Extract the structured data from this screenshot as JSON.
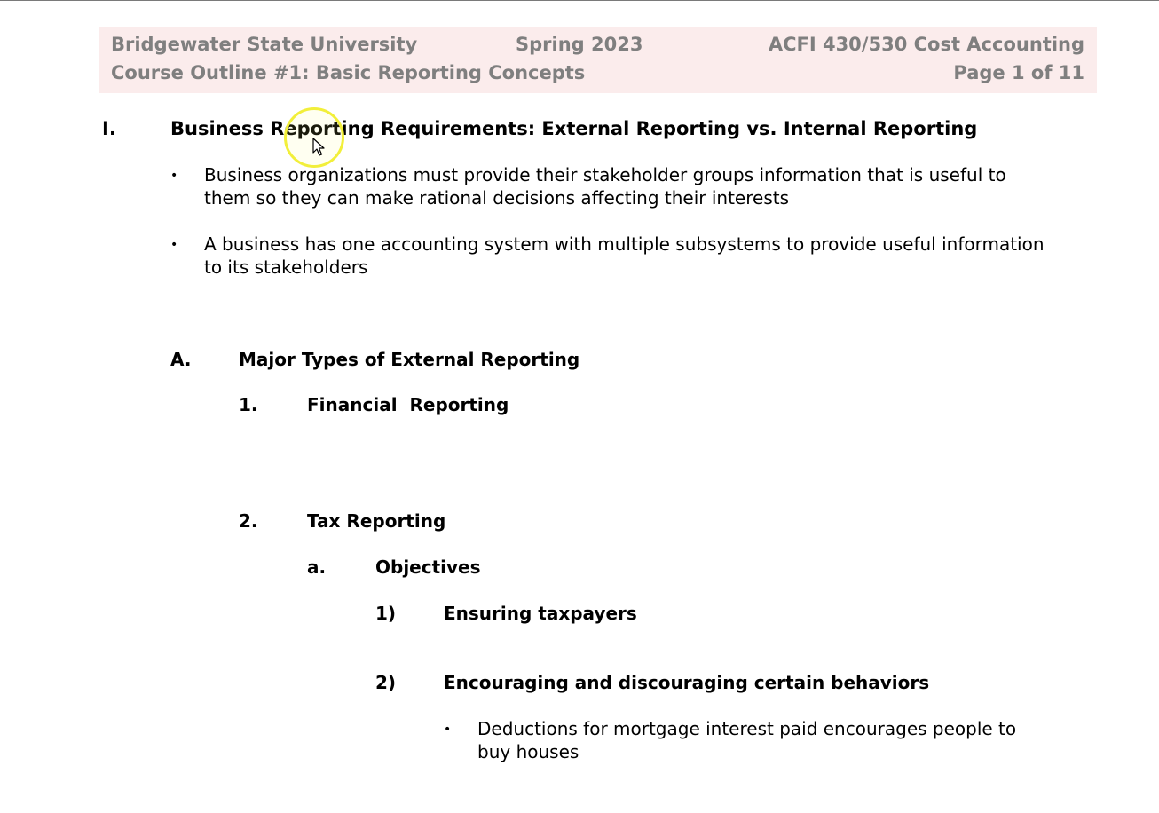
{
  "header": {
    "university": "Bridgewater State University",
    "term": "Spring 2023",
    "course": "ACFI 430/530 Cost Accounting",
    "outline_title": "Course Outline #1: Basic Reporting Concepts",
    "page": "Page 1 of 11"
  },
  "section_I": {
    "number": "I.",
    "title": "Business Reporting Requirements: External Reporting vs. Internal Reporting",
    "bullets": [
      {
        "line1": "Business organizations must provide their stakeholder groups information that is useful to",
        "line2": "them so they can make rational decisions affecting their interests"
      },
      {
        "line1": "A business has one accounting system with multiple subsystems to provide useful information",
        "line2": "to its stakeholders"
      }
    ]
  },
  "section_A": {
    "number": "A.",
    "title": "Major Types of External Reporting"
  },
  "item_1": {
    "number": "1.",
    "title": "Financial  Reporting"
  },
  "item_2": {
    "number": "2.",
    "title": "Tax Reporting"
  },
  "item_a": {
    "number": "a.",
    "title": "Objectives"
  },
  "item_1p": {
    "number": "1)",
    "title": "Ensuring taxpayers"
  },
  "item_2p": {
    "number": "2)",
    "title": "Encouraging and discouraging certain behaviors"
  },
  "item_2p_bullet": {
    "line1": "Deductions for mortgage interest paid encourages people to",
    "line2": "buy houses"
  },
  "bullet_glyph": "•",
  "colors": {
    "header_bg": "#fbecec",
    "header_text": "#7f7f7f",
    "cursor_ring": "#f2ef3a"
  }
}
